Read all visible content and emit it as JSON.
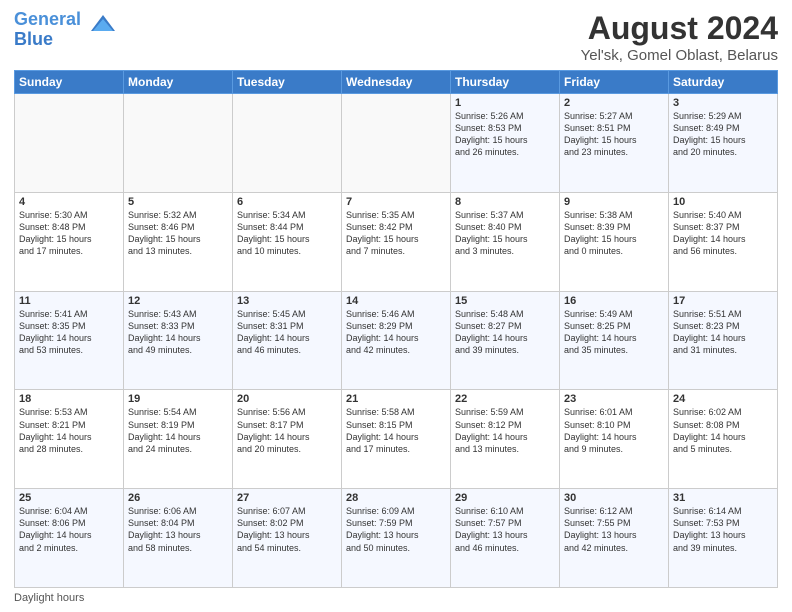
{
  "header": {
    "logo_line1": "General",
    "logo_line2": "Blue",
    "title": "August 2024",
    "subtitle": "Yel'sk, Gomel Oblast, Belarus"
  },
  "days_of_week": [
    "Sunday",
    "Monday",
    "Tuesday",
    "Wednesday",
    "Thursday",
    "Friday",
    "Saturday"
  ],
  "footer": {
    "label": "Daylight hours"
  },
  "weeks": [
    [
      {
        "day": "",
        "info": ""
      },
      {
        "day": "",
        "info": ""
      },
      {
        "day": "",
        "info": ""
      },
      {
        "day": "",
        "info": ""
      },
      {
        "day": "1",
        "info": "Sunrise: 5:26 AM\nSunset: 8:53 PM\nDaylight: 15 hours\nand 26 minutes."
      },
      {
        "day": "2",
        "info": "Sunrise: 5:27 AM\nSunset: 8:51 PM\nDaylight: 15 hours\nand 23 minutes."
      },
      {
        "day": "3",
        "info": "Sunrise: 5:29 AM\nSunset: 8:49 PM\nDaylight: 15 hours\nand 20 minutes."
      }
    ],
    [
      {
        "day": "4",
        "info": "Sunrise: 5:30 AM\nSunset: 8:48 PM\nDaylight: 15 hours\nand 17 minutes."
      },
      {
        "day": "5",
        "info": "Sunrise: 5:32 AM\nSunset: 8:46 PM\nDaylight: 15 hours\nand 13 minutes."
      },
      {
        "day": "6",
        "info": "Sunrise: 5:34 AM\nSunset: 8:44 PM\nDaylight: 15 hours\nand 10 minutes."
      },
      {
        "day": "7",
        "info": "Sunrise: 5:35 AM\nSunset: 8:42 PM\nDaylight: 15 hours\nand 7 minutes."
      },
      {
        "day": "8",
        "info": "Sunrise: 5:37 AM\nSunset: 8:40 PM\nDaylight: 15 hours\nand 3 minutes."
      },
      {
        "day": "9",
        "info": "Sunrise: 5:38 AM\nSunset: 8:39 PM\nDaylight: 15 hours\nand 0 minutes."
      },
      {
        "day": "10",
        "info": "Sunrise: 5:40 AM\nSunset: 8:37 PM\nDaylight: 14 hours\nand 56 minutes."
      }
    ],
    [
      {
        "day": "11",
        "info": "Sunrise: 5:41 AM\nSunset: 8:35 PM\nDaylight: 14 hours\nand 53 minutes."
      },
      {
        "day": "12",
        "info": "Sunrise: 5:43 AM\nSunset: 8:33 PM\nDaylight: 14 hours\nand 49 minutes."
      },
      {
        "day": "13",
        "info": "Sunrise: 5:45 AM\nSunset: 8:31 PM\nDaylight: 14 hours\nand 46 minutes."
      },
      {
        "day": "14",
        "info": "Sunrise: 5:46 AM\nSunset: 8:29 PM\nDaylight: 14 hours\nand 42 minutes."
      },
      {
        "day": "15",
        "info": "Sunrise: 5:48 AM\nSunset: 8:27 PM\nDaylight: 14 hours\nand 39 minutes."
      },
      {
        "day": "16",
        "info": "Sunrise: 5:49 AM\nSunset: 8:25 PM\nDaylight: 14 hours\nand 35 minutes."
      },
      {
        "day": "17",
        "info": "Sunrise: 5:51 AM\nSunset: 8:23 PM\nDaylight: 14 hours\nand 31 minutes."
      }
    ],
    [
      {
        "day": "18",
        "info": "Sunrise: 5:53 AM\nSunset: 8:21 PM\nDaylight: 14 hours\nand 28 minutes."
      },
      {
        "day": "19",
        "info": "Sunrise: 5:54 AM\nSunset: 8:19 PM\nDaylight: 14 hours\nand 24 minutes."
      },
      {
        "day": "20",
        "info": "Sunrise: 5:56 AM\nSunset: 8:17 PM\nDaylight: 14 hours\nand 20 minutes."
      },
      {
        "day": "21",
        "info": "Sunrise: 5:58 AM\nSunset: 8:15 PM\nDaylight: 14 hours\nand 17 minutes."
      },
      {
        "day": "22",
        "info": "Sunrise: 5:59 AM\nSunset: 8:12 PM\nDaylight: 14 hours\nand 13 minutes."
      },
      {
        "day": "23",
        "info": "Sunrise: 6:01 AM\nSunset: 8:10 PM\nDaylight: 14 hours\nand 9 minutes."
      },
      {
        "day": "24",
        "info": "Sunrise: 6:02 AM\nSunset: 8:08 PM\nDaylight: 14 hours\nand 5 minutes."
      }
    ],
    [
      {
        "day": "25",
        "info": "Sunrise: 6:04 AM\nSunset: 8:06 PM\nDaylight: 14 hours\nand 2 minutes."
      },
      {
        "day": "26",
        "info": "Sunrise: 6:06 AM\nSunset: 8:04 PM\nDaylight: 13 hours\nand 58 minutes."
      },
      {
        "day": "27",
        "info": "Sunrise: 6:07 AM\nSunset: 8:02 PM\nDaylight: 13 hours\nand 54 minutes."
      },
      {
        "day": "28",
        "info": "Sunrise: 6:09 AM\nSunset: 7:59 PM\nDaylight: 13 hours\nand 50 minutes."
      },
      {
        "day": "29",
        "info": "Sunrise: 6:10 AM\nSunset: 7:57 PM\nDaylight: 13 hours\nand 46 minutes."
      },
      {
        "day": "30",
        "info": "Sunrise: 6:12 AM\nSunset: 7:55 PM\nDaylight: 13 hours\nand 42 minutes."
      },
      {
        "day": "31",
        "info": "Sunrise: 6:14 AM\nSunset: 7:53 PM\nDaylight: 13 hours\nand 39 minutes."
      }
    ]
  ]
}
